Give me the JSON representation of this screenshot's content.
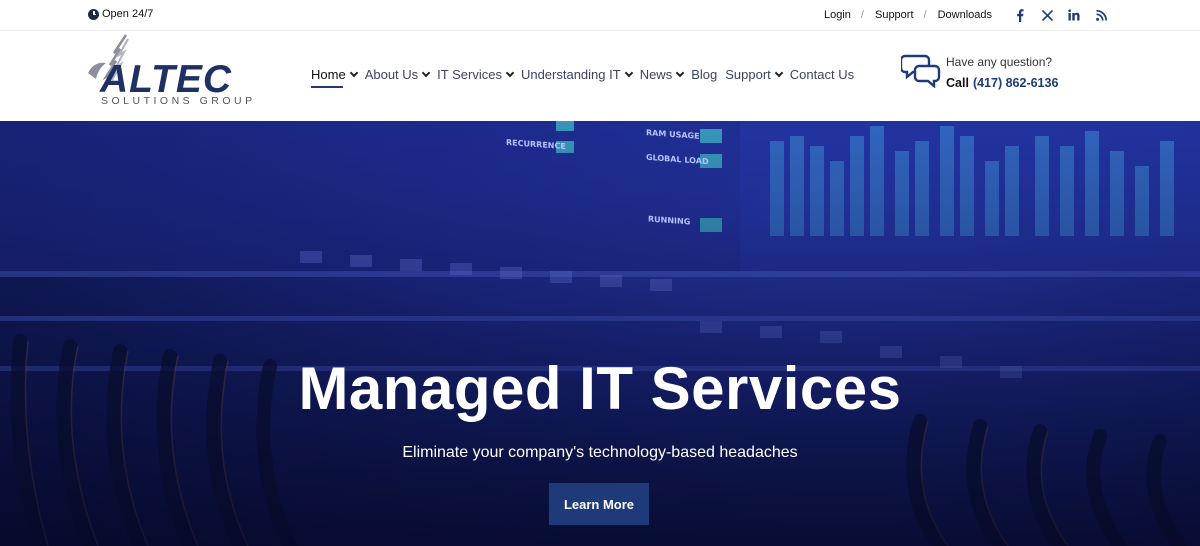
{
  "topbar": {
    "hours": "Open 24/7",
    "links": [
      {
        "label": "Login"
      },
      {
        "label": "Support"
      },
      {
        "label": "Downloads"
      }
    ],
    "separator": "/",
    "social": [
      "facebook-icon",
      "x-twitter-icon",
      "linkedin-icon",
      "rss-icon"
    ]
  },
  "logo": {
    "word": "ALTEC",
    "subtitle": "SOLUTIONS GROUP"
  },
  "nav": {
    "items": [
      {
        "label": "Home",
        "dropdown": true,
        "active": true
      },
      {
        "label": "About Us",
        "dropdown": true
      },
      {
        "label": "IT Services",
        "dropdown": true
      },
      {
        "label": "Understanding IT",
        "dropdown": true
      },
      {
        "label": "News",
        "dropdown": true
      },
      {
        "label": "Blog",
        "dropdown": false
      },
      {
        "label": "Support",
        "dropdown": true
      },
      {
        "label": "Contact Us",
        "dropdown": false
      }
    ]
  },
  "contact": {
    "question": "Have any question?",
    "call_label": "Call",
    "phone": "(417) 862-6136"
  },
  "hero": {
    "title": "Managed IT Services",
    "subtitle": "Eliminate your company's technology-based headaches",
    "button": "Learn More",
    "panel_labels": [
      "RECURRENCE",
      "RAM USAGE",
      "GLOBAL LOAD",
      "RUNNING"
    ]
  },
  "colors": {
    "brand_navy": "#1e3a78",
    "hero_blue": "#1e2c8f",
    "text_dark": "#111111"
  }
}
